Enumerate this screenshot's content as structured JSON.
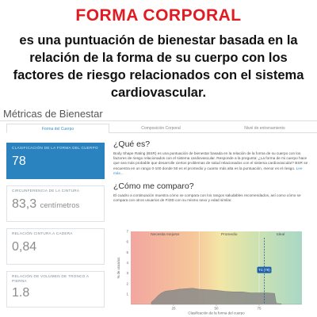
{
  "headline": "FORMA CORPORAL",
  "subheadline": "es una puntuación de bienestar basada en la relación de la forma de su cuerpo con los factores de riesgo relacionados con el sistema cardiovascular.",
  "app": {
    "title": "Métricas de Bienestar"
  },
  "tabs": [
    {
      "label": "Forma del Cuerpo",
      "active": true
    },
    {
      "label": "Composición Corporal",
      "active": false
    },
    {
      "label": "Nivel de entrenamiento",
      "active": false
    }
  ],
  "metrics": [
    {
      "label": "CLASIFICACIÓN DE LA FORMA DEL CUERPO",
      "value": "78",
      "unit": "",
      "active": true
    },
    {
      "label": "CIRCUNFERENCIA DE LA CINTURA",
      "value": "83,3",
      "unit": "centímetros",
      "active": false
    },
    {
      "label": "RELACIÓN CINTURA A CADERA",
      "value": "0,84",
      "unit": "",
      "active": false
    },
    {
      "label": "RELACIÓN DE VOLUMEN DE TRONCO A PIERNA",
      "value": "1.8",
      "unit": "",
      "active": false
    }
  ],
  "what": {
    "heading": "¿Qué es?",
    "text": "Body Shape Rating (BSR) es una puntuación de bienestar basada en la relación de la forma de su cuerpo con los factores de riesgo relacionados con el sistema cardiovascular. Responde a la pregunta: ¿La forma de mi cuerpo hace que sea más probable que desarrolle ciertos problemas de salud relacionados con el sistema cardiovascular? BSR se encuentra en un rango 0-100 donde 50 es el promedio y cuanto más alta es la puntuación, menor es el riesgo.",
    "more": "Lee más..."
  },
  "compare": {
    "heading": "¿Cómo me comparo?",
    "text": "El cuadro a continuación muestra cómo se compara con los rangos saludables recomendados, así como cómo se compara con otros usuarios de Fit3D con su mismo sexo y edad similar."
  },
  "chart_data": {
    "type": "area",
    "ylabel": "% de usuarios",
    "xlabel": "Clasificación de la forma del cuerpo",
    "xlim": [
      0,
      100
    ],
    "ylim": [
      0,
      7
    ],
    "yticks": [
      1,
      2,
      3,
      4,
      5,
      6,
      7
    ],
    "xticks": [
      25,
      50,
      75
    ],
    "bands": [
      {
        "label": "Necesita mejorar",
        "from": 0,
        "to": 40
      },
      {
        "label": "Promedio",
        "from": 40,
        "to": 75
      },
      {
        "label": "Ideal",
        "from": 75,
        "to": 100
      }
    ],
    "marker": {
      "label": "Tú (78)",
      "x": 78,
      "color": "#1f5fa8"
    },
    "distribution": {
      "x": [
        12,
        14,
        16,
        18,
        20,
        22,
        25,
        28,
        32,
        36,
        40,
        45,
        50,
        55,
        60,
        65,
        70,
        75,
        80,
        84,
        85,
        88
      ],
      "y": [
        0.2,
        0.5,
        0.85,
        1.1,
        1.25,
        1.3,
        1.35,
        1.45,
        1.5,
        1.55,
        1.45,
        1.4,
        1.35,
        1.25,
        1.2,
        1.2,
        1.1,
        1.1,
        1.1,
        1.05,
        0.1,
        0.05
      ]
    }
  }
}
